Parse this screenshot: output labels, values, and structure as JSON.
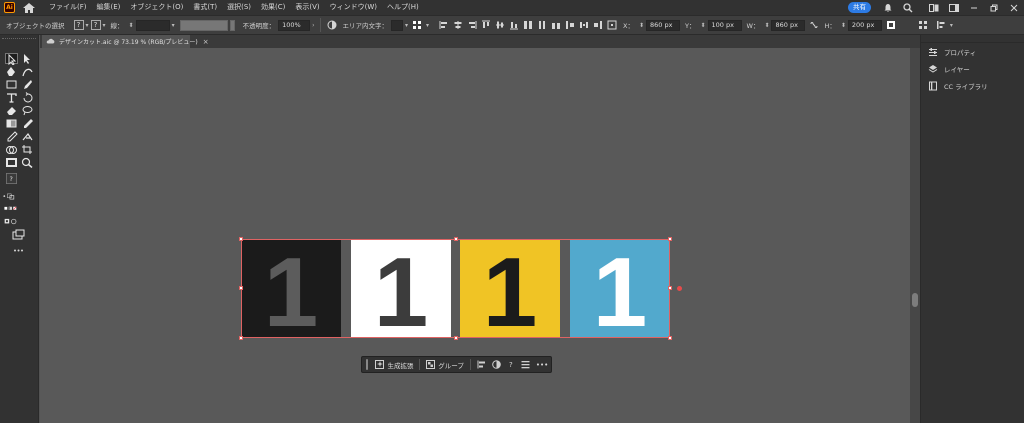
{
  "app": {
    "logo_text": "Ai"
  },
  "menu": {
    "items": [
      {
        "label": "ファイル(F)"
      },
      {
        "label": "編集(E)"
      },
      {
        "label": "オブジェクト(O)"
      },
      {
        "label": "書式(T)"
      },
      {
        "label": "選択(S)"
      },
      {
        "label": "効果(C)"
      },
      {
        "label": "表示(V)"
      },
      {
        "label": "ウィンドウ(W)"
      },
      {
        "label": "ヘルプ(H)"
      }
    ],
    "share_label": "共有"
  },
  "control_bar": {
    "object_label": "オブジェクトの選択",
    "fill_glyph": "?",
    "stroke_glyph": "?",
    "stroke_label": "線：",
    "opacity_label": "不透明度：",
    "opacity_value": "100%",
    "area_type_label": "エリア内文字：",
    "x_label": "X：",
    "x_value": "860 px",
    "y_label": "Y：",
    "y_value": "100 px",
    "w_label": "W：",
    "w_value": "860 px",
    "h_label": "H：",
    "h_value": "200 px"
  },
  "document": {
    "tab_title": "デザインカット.aic @ 73.19 % (RGB/プレビュー)"
  },
  "tiles": [
    {
      "digit": "1",
      "bg": "#1b1b1b",
      "fg": "#5c5c5c"
    },
    {
      "digit": "1",
      "bg": "#ffffff",
      "fg": "#3c3c3c"
    },
    {
      "digit": "1",
      "bg": "#f0c425",
      "fg": "#1b1b1b"
    },
    {
      "digit": "1",
      "bg": "#52a9cd",
      "fg": "#ffffff"
    }
  ],
  "right_panel": {
    "items": [
      {
        "label": "プロパティ",
        "icon": "properties-icon"
      },
      {
        "label": "レイヤー",
        "icon": "layers-icon"
      },
      {
        "label": "CC ライブラリ",
        "icon": "cc-libraries-icon"
      }
    ]
  },
  "taskbar": {
    "generative_label": "生成拡張",
    "group_label": "グループ",
    "help_glyph": "?",
    "more_glyph": "•••"
  },
  "colors": {
    "accent": "#2d7be5",
    "selection": "#e06363",
    "canvas": "#595959"
  }
}
